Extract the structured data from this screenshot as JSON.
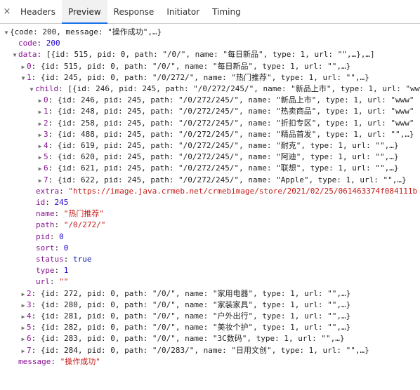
{
  "tabs": {
    "close": "×",
    "items": [
      "Headers",
      "Preview",
      "Response",
      "Initiator",
      "Timing"
    ],
    "active": 1
  },
  "tree": {
    "root_summary": "{code: 200, message: \"操作成功\",…}",
    "code_key": "code",
    "code_val": "200",
    "data_key": "data",
    "data_summary": "[{id: 515, pid: 0, path: \"/0/\", name: \"每日新品\", type: 1, url: \"\",…},…]",
    "items": [
      {
        "idx": "0",
        "summary": "{id: 515, pid: 0, path: \"/0/\", name: \"每日新品\", type: 1, url: \"\",…}"
      },
      {
        "idx": "1",
        "summary": "{id: 245, pid: 0, path: \"/0/272/\", name: \"热门推荐\", type: 1, url: \"\",…}"
      }
    ],
    "child_key": "child",
    "child_summary": "[{id: 246, pid: 245, path: \"/0/272/245/\", name: \"新品上市\", type: 1, url: \"www",
    "children": [
      {
        "idx": "0",
        "summary": "{id: 246, pid: 245, path: \"/0/272/245/\", name: \"新品上市\", type: 1, url: \"www\""
      },
      {
        "idx": "1",
        "summary": "{id: 248, pid: 245, path: \"/0/272/245/\", name: \"热卖商品\", type: 1, url: \"www\""
      },
      {
        "idx": "2",
        "summary": "{id: 258, pid: 245, path: \"/0/272/245/\", name: \"折扣专区\", type: 1, url: \"www\""
      },
      {
        "idx": "3",
        "summary": "{id: 488, pid: 245, path: \"/0/272/245/\", name: \"精品首发\", type: 1, url: \"\",…}"
      },
      {
        "idx": "4",
        "summary": "{id: 619, pid: 245, path: \"/0/272/245/\", name: \"耐克\", type: 1, url: \"\",…}"
      },
      {
        "idx": "5",
        "summary": "{id: 620, pid: 245, path: \"/0/272/245/\", name: \"阿迪\", type: 1, url: \"\",…}"
      },
      {
        "idx": "6",
        "summary": "{id: 621, pid: 245, path: \"/0/272/245/\", name: \"联想\", type: 1, url: \"\",…}"
      },
      {
        "idx": "7",
        "summary": "{id: 622, pid: 245, path: \"/0/272/245/\", name: \"Apple\", type: 1, url: \"\",…}"
      }
    ],
    "props": [
      {
        "key": "extra",
        "val": "\"https://image.java.crmeb.net/crmebimage/store/2021/02/25/061463374f084111b",
        "kind": "s"
      },
      {
        "key": "id",
        "val": "245",
        "kind": "n"
      },
      {
        "key": "name",
        "val": "\"热门推荐\"",
        "kind": "s"
      },
      {
        "key": "path",
        "val": "\"/0/272/\"",
        "kind": "s"
      },
      {
        "key": "pid",
        "val": "0",
        "kind": "n"
      },
      {
        "key": "sort",
        "val": "0",
        "kind": "n"
      },
      {
        "key": "status",
        "val": "true",
        "kind": "b"
      },
      {
        "key": "type",
        "val": "1",
        "kind": "n"
      },
      {
        "key": "url",
        "val": "\"\"",
        "kind": "s"
      }
    ],
    "more_items": [
      {
        "idx": "2",
        "summary": "{id: 272, pid: 0, path: \"/0/\", name: \"家用电器\", type: 1, url: \"\",…}"
      },
      {
        "idx": "3",
        "summary": "{id: 280, pid: 0, path: \"/0/\", name: \"家装家具\", type: 1, url: \"\",…}"
      },
      {
        "idx": "4",
        "summary": "{id: 281, pid: 0, path: \"/0/\", name: \"户外出行\", type: 1, url: \"\",…}"
      },
      {
        "idx": "5",
        "summary": "{id: 282, pid: 0, path: \"/0/\", name: \"美妆个护\", type: 1, url: \"\",…}"
      },
      {
        "idx": "6",
        "summary": "{id: 283, pid: 0, path: \"/0/\", name: \"3C数码\", type: 1, url: \"\",…}"
      },
      {
        "idx": "7",
        "summary": "{id: 284, pid: 0, path: \"/0/283/\", name: \"日用文创\", type: 1, url: \"\",…}"
      }
    ],
    "message_key": "message",
    "message_val": "\"操作成功\""
  }
}
